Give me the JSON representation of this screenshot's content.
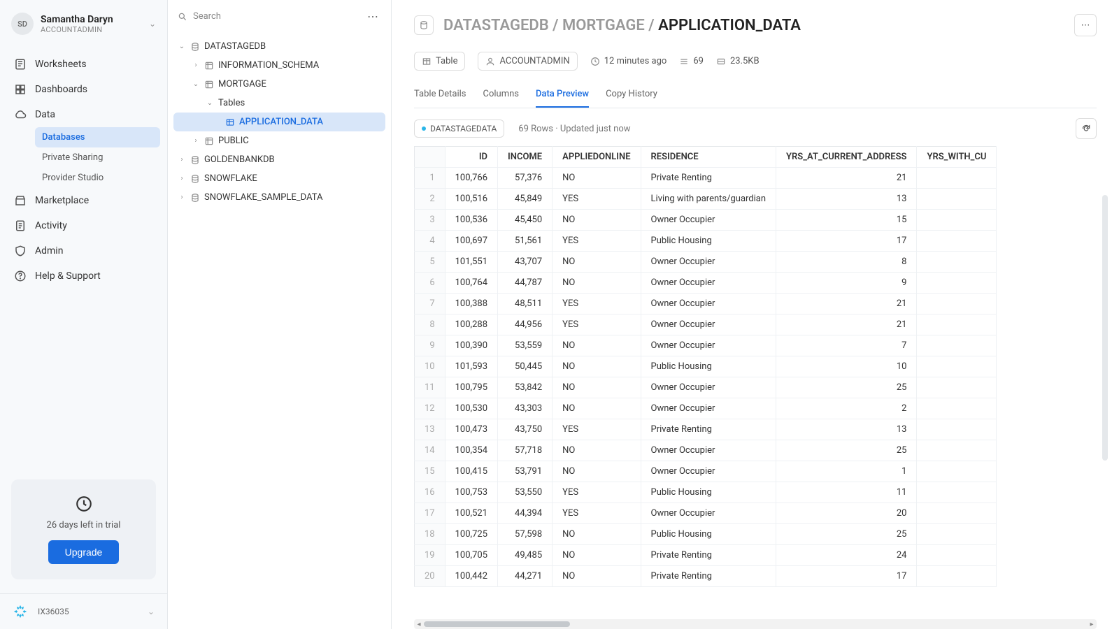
{
  "user": {
    "initials": "SD",
    "name": "Samantha Daryn",
    "role": "ACCOUNTADMIN"
  },
  "nav": {
    "worksheets": "Worksheets",
    "dashboards": "Dashboards",
    "data": "Data",
    "data_sub": {
      "databases": "Databases",
      "private_sharing": "Private Sharing",
      "provider_studio": "Provider Studio"
    },
    "marketplace": "Marketplace",
    "activity": "Activity",
    "admin": "Admin",
    "help": "Help & Support"
  },
  "trial": {
    "text": "26 days left in trial",
    "button": "Upgrade"
  },
  "footer": {
    "id": "IX36035"
  },
  "explorer": {
    "search": "Search",
    "nodes": {
      "datastagedb": "DATASTAGEDB",
      "info_schema": "INFORMATION_SCHEMA",
      "mortgage": "MORTGAGE",
      "tables": "Tables",
      "application_data": "APPLICATION_DATA",
      "public": "PUBLIC",
      "goldenbankdb": "GOLDENBANKDB",
      "snowflake": "SNOWFLAKE",
      "sample_data": "SNOWFLAKE_SAMPLE_DATA"
    }
  },
  "breadcrumb": {
    "db": "DATASTAGEDB",
    "schema": "MORTGAGE",
    "table": "APPLICATION_DATA"
  },
  "meta": {
    "type": "Table",
    "role": "ACCOUNTADMIN",
    "time": "12 minutes ago",
    "rows": "69",
    "size": "23.5KB"
  },
  "tabs": {
    "details": "Table Details",
    "columns": "Columns",
    "preview": "Data Preview",
    "history": "Copy History"
  },
  "preview": {
    "badge": "DATASTAGEDATA",
    "status": "69 Rows · Updated just now"
  },
  "columns": [
    "ID",
    "INCOME",
    "APPLIEDONLINE",
    "RESIDENCE",
    "YRS_AT_CURRENT_ADDRESS",
    "YRS_WITH_CU"
  ],
  "rows": [
    {
      "n": 1,
      "id": "100,766",
      "income": "57,376",
      "applied": "NO",
      "res": "Private Renting",
      "yrs": "21"
    },
    {
      "n": 2,
      "id": "100,516",
      "income": "45,849",
      "applied": "YES",
      "res": "Living with parents/guardian",
      "yrs": "13"
    },
    {
      "n": 3,
      "id": "100,536",
      "income": "45,450",
      "applied": "NO",
      "res": "Owner Occupier",
      "yrs": "15"
    },
    {
      "n": 4,
      "id": "100,697",
      "income": "51,561",
      "applied": "YES",
      "res": "Public Housing",
      "yrs": "17"
    },
    {
      "n": 5,
      "id": "101,551",
      "income": "43,707",
      "applied": "NO",
      "res": "Owner Occupier",
      "yrs": "8"
    },
    {
      "n": 6,
      "id": "100,764",
      "income": "44,787",
      "applied": "NO",
      "res": "Owner Occupier",
      "yrs": "9"
    },
    {
      "n": 7,
      "id": "100,388",
      "income": "48,511",
      "applied": "YES",
      "res": "Owner Occupier",
      "yrs": "21"
    },
    {
      "n": 8,
      "id": "100,288",
      "income": "44,956",
      "applied": "YES",
      "res": "Owner Occupier",
      "yrs": "21"
    },
    {
      "n": 9,
      "id": "100,390",
      "income": "53,559",
      "applied": "NO",
      "res": "Owner Occupier",
      "yrs": "7"
    },
    {
      "n": 10,
      "id": "101,593",
      "income": "50,445",
      "applied": "NO",
      "res": "Public Housing",
      "yrs": "10"
    },
    {
      "n": 11,
      "id": "100,795",
      "income": "53,842",
      "applied": "NO",
      "res": "Owner Occupier",
      "yrs": "25"
    },
    {
      "n": 12,
      "id": "100,530",
      "income": "43,303",
      "applied": "NO",
      "res": "Owner Occupier",
      "yrs": "2"
    },
    {
      "n": 13,
      "id": "100,473",
      "income": "43,750",
      "applied": "YES",
      "res": "Private Renting",
      "yrs": "13"
    },
    {
      "n": 14,
      "id": "100,354",
      "income": "57,718",
      "applied": "NO",
      "res": "Owner Occupier",
      "yrs": "25"
    },
    {
      "n": 15,
      "id": "100,415",
      "income": "53,791",
      "applied": "NO",
      "res": "Owner Occupier",
      "yrs": "1"
    },
    {
      "n": 16,
      "id": "100,753",
      "income": "53,550",
      "applied": "YES",
      "res": "Public Housing",
      "yrs": "11"
    },
    {
      "n": 17,
      "id": "100,521",
      "income": "44,394",
      "applied": "YES",
      "res": "Owner Occupier",
      "yrs": "20"
    },
    {
      "n": 18,
      "id": "100,725",
      "income": "57,598",
      "applied": "NO",
      "res": "Public Housing",
      "yrs": "25"
    },
    {
      "n": 19,
      "id": "100,705",
      "income": "49,485",
      "applied": "NO",
      "res": "Private Renting",
      "yrs": "24"
    },
    {
      "n": 20,
      "id": "100,442",
      "income": "44,271",
      "applied": "NO",
      "res": "Private Renting",
      "yrs": "17"
    }
  ]
}
